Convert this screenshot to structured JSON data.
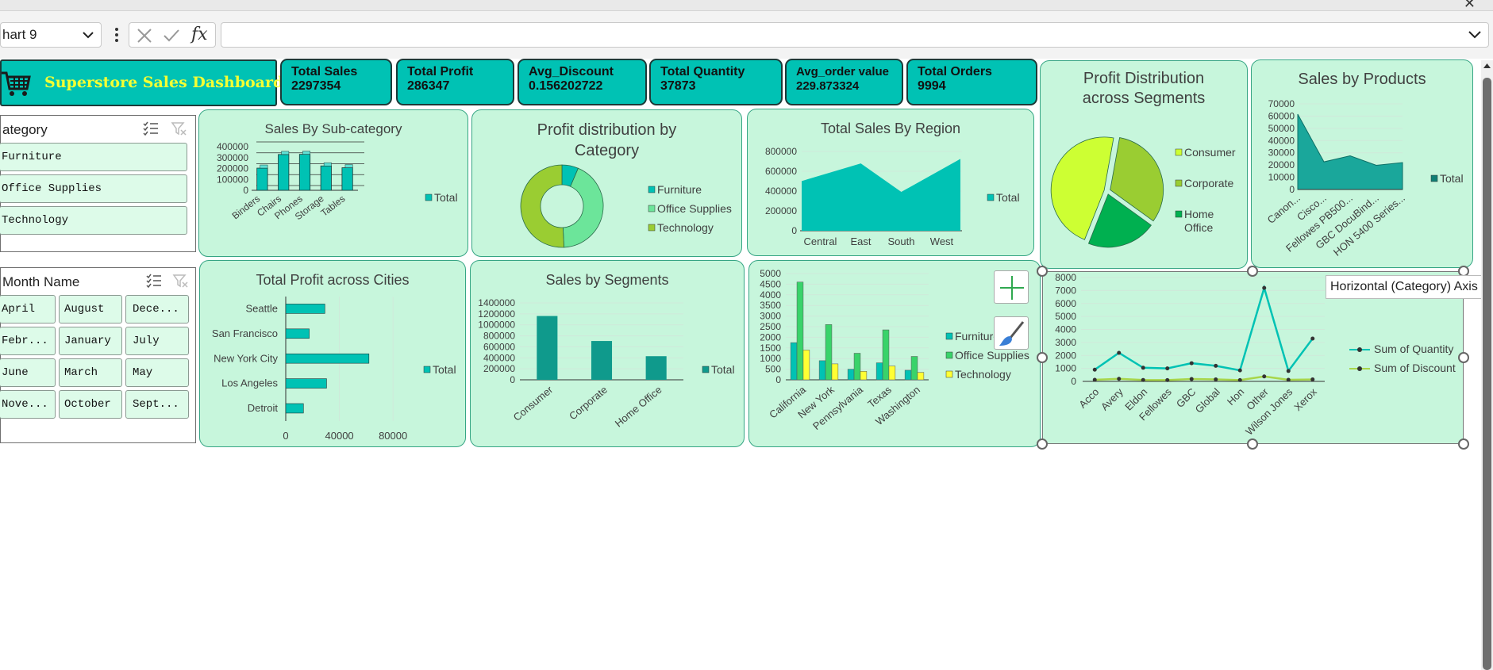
{
  "formula_bar": {
    "name_box": "hart 9",
    "formula": ""
  },
  "dashboard": {
    "title": "Superstore Sales Dashboard"
  },
  "kpis": [
    {
      "label": "Total Sales",
      "value": "2297354"
    },
    {
      "label": "Total Profit",
      "value": "286347"
    },
    {
      "label": "Avg_Discount",
      "value": "0.156202722"
    },
    {
      "label": "Total Quantity",
      "value": "37873"
    },
    {
      "label": "Avg_order value",
      "value": "229.873324"
    },
    {
      "label": "Total Orders",
      "value": "9994"
    }
  ],
  "slicers": {
    "category": {
      "title": "ategory",
      "items": [
        "Furniture",
        "Office Supplies",
        "Technology"
      ]
    },
    "month": {
      "title": "Month Name",
      "items": [
        "April",
        "August",
        "Dece...",
        "Febr...",
        "January",
        "July",
        "June",
        "March",
        "May",
        "Nove...",
        "October",
        "Sept..."
      ]
    }
  },
  "tooltip": "Horizontal (Category) Axis",
  "colors": {
    "teal": "#00c2b4",
    "panel": "#c7f6dc",
    "dark_teal": "#009a8b",
    "lime": "#cdff33",
    "olive": "#9acd32",
    "green": "#00b050",
    "yellow": "#ffff33"
  },
  "chart_data": [
    {
      "id": "sub",
      "type": "bar",
      "title": "Sales By Sub-category",
      "categories": [
        "Binders",
        "Chairs",
        "Phones",
        "Storage",
        "Tables"
      ],
      "series": [
        {
          "name": "Total",
          "values": [
            203413,
            328449,
            330007,
            223844,
            206966
          ]
        }
      ],
      "ylim": [
        0,
        400000
      ],
      "yticks": [
        "400000",
        "300000",
        "200000",
        "100000",
        "0"
      ]
    },
    {
      "id": "cat",
      "type": "pie",
      "title": "Profit distribution by Category",
      "categories": [
        "Furniture",
        "Office Supplies",
        "Technology"
      ],
      "values": [
        18451,
        122491,
        145455
      ]
    },
    {
      "id": "region",
      "type": "area",
      "title": "Total Sales By Region",
      "categories": [
        "Central",
        "East",
        "South",
        "West"
      ],
      "series": [
        {
          "name": "Total",
          "values": [
            501240,
            678781,
            391722,
            725458
          ]
        }
      ],
      "ylim": [
        0,
        800000
      ],
      "yticks": [
        "800000",
        "600000",
        "400000",
        "200000",
        "0"
      ]
    },
    {
      "id": "seg_profit",
      "type": "pie",
      "title": "Profit Distribution across Segments",
      "categories": [
        "Consumer",
        "Corporate",
        "Home Office"
      ],
      "values": [
        134119,
        91979,
        60299
      ]
    },
    {
      "id": "products",
      "type": "area",
      "title": "Sales by Products",
      "categories": [
        "Canon...",
        "Cisco...",
        "Fellowes PB500...",
        "GBC DocuBind...",
        "HON 5400 Series..."
      ],
      "series": [
        {
          "name": "Total",
          "values": [
            61600,
            22600,
            27500,
            19800,
            22000
          ]
        }
      ],
      "ylim": [
        0,
        70000
      ],
      "yticks": [
        "70000",
        "60000",
        "50000",
        "40000",
        "30000",
        "20000",
        "10000",
        "0"
      ]
    },
    {
      "id": "cities",
      "type": "bar",
      "title": "Total Profit across Cities",
      "categories": [
        "Seattle",
        "San Francisco",
        "New York City",
        "Los Angeles",
        "Detroit"
      ],
      "series": [
        {
          "name": "Total",
          "values": [
            29156,
            17507,
            62037,
            30440,
            13181
          ]
        }
      ],
      "xlim": [
        0,
        100000
      ],
      "xticks": [
        "0",
        "40000",
        "80000"
      ]
    },
    {
      "id": "segments",
      "type": "bar",
      "title": "Sales by Segments",
      "categories": [
        "Consumer",
        "Corporate",
        "Home Office"
      ],
      "series": [
        {
          "name": "Total",
          "values": [
            1161401,
            706146,
            429653
          ]
        }
      ],
      "ylim": [
        0,
        1400000
      ],
      "yticks": [
        "1400000",
        "1200000",
        "1000000",
        "800000",
        "600000",
        "400000",
        "200000",
        "0"
      ]
    },
    {
      "id": "states",
      "type": "bar",
      "title": "",
      "categories": [
        "California",
        "New York",
        "Pennsylvania",
        "Texas",
        "Washington"
      ],
      "series": [
        {
          "name": "Furniture",
          "values": [
            1750,
            900,
            500,
            800,
            450
          ]
        },
        {
          "name": "Office Supplies",
          "values": [
            4600,
            2600,
            1250,
            2350,
            1100
          ]
        },
        {
          "name": "Technology",
          "values": [
            1400,
            750,
            400,
            650,
            350
          ]
        }
      ],
      "ylim": [
        0,
        5000
      ],
      "yticks": [
        "5000",
        "4500",
        "4000",
        "3500",
        "3000",
        "2500",
        "2000",
        "1500",
        "1000",
        "500",
        "0"
      ]
    },
    {
      "id": "brands",
      "type": "line",
      "title": "",
      "categories": [
        "Acco",
        "Avery",
        "Eldon",
        "Fellowes",
        "GBC",
        "Global",
        "Hon",
        "Other",
        "Wilson Jones",
        "Xerox"
      ],
      "series": [
        {
          "name": "Sum of Quantity",
          "values": [
            900,
            2200,
            1050,
            1000,
            1400,
            1200,
            850,
            7200,
            800,
            3300
          ]
        },
        {
          "name": "Sum of Discount",
          "values": [
            120,
            200,
            110,
            100,
            180,
            150,
            100,
            380,
            120,
            150
          ]
        }
      ],
      "ylim": [
        0,
        8000
      ],
      "yticks": [
        "8000",
        "7000",
        "6000",
        "5000",
        "4000",
        "3000",
        "2000",
        "1000",
        "0"
      ]
    }
  ]
}
